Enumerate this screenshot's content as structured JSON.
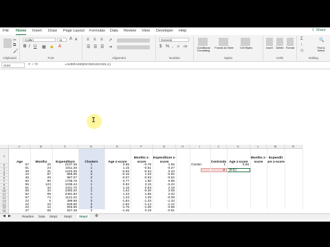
{
  "ribbon_tabs": [
    "File",
    "Home",
    "Insert",
    "Draw",
    "Page Layout",
    "Formulas",
    "Data",
    "Review",
    "View",
    "Developer",
    "Help"
  ],
  "active_tab": "Home",
  "share_label": "Share",
  "groups": {
    "clipboard": "Clipboard",
    "font": "Font",
    "alignment": "Alignment",
    "number": "Number",
    "styles": "Styles",
    "cells": "Cells",
    "editing": "Editing"
  },
  "font_name": "Calibri",
  "font_size": "11",
  "number_format": "General",
  "styles_buttons": [
    "Conditional Formatting",
    "Format as Table",
    "Cell Styles"
  ],
  "cells_buttons": [
    "Insert",
    "Delete",
    "Format"
  ],
  "editing_buttons": [
    "Find & Select"
  ],
  "name_box": "SUM",
  "formula": "=AVERAGE(D2:D20,D2:D21,1)",
  "columns": [
    "A",
    "B",
    "C",
    "D",
    "E",
    "F",
    "G",
    "H",
    "I",
    "J",
    "K",
    "L",
    "M",
    "N"
  ],
  "headers": {
    "age": "Age",
    "months": "Months",
    "expenditure": "Expenditure",
    "clusters": "Clusters",
    "age_z": "Age z-score",
    "months_z": "Months z-score",
    "expenditure_z": "Expenditure z-score",
    "centroids": "Centroids",
    "k_age_z": "Age z-score",
    "l_months_z": "Months z-score",
    "m_expenditure_z": "Expendit ure z-score"
  },
  "cluster_label": "Cluster",
  "cluster_row": {
    "cluster": "1",
    "value": "0.58"
  },
  "editing_cell": {
    "cluster": "2",
    "value": "(E:E)"
  },
  "rows": [
    {
      "n": "2",
      "age": "57",
      "months": "20",
      "exp": "2107.35",
      "cl": "1",
      "az": "0.65",
      "mz": "-0.76",
      "ez": "1.65"
    },
    {
      "n": "3",
      "age": "61",
      "months": "24",
      "exp": "1011.25",
      "cl": "1",
      "az": "1.15",
      "mz": "-0.61",
      "ez": "-0.27"
    },
    {
      "n": "4",
      "age": "39",
      "months": "31",
      "exp": "1223.35",
      "cl": "2",
      "az": "-0.53",
      "mz": "-0.34",
      "ez": "0.10"
    },
    {
      "n": "5",
      "age": "44",
      "months": "87",
      "exp": "865.85",
      "cl": "2",
      "az": "-0.15",
      "mz": "1.33",
      "ez": "-0.92"
    },
    {
      "n": "6",
      "age": "45",
      "months": "26",
      "exp": "867.07",
      "cl": "2",
      "az": "-0.07",
      "mz": "-0.53",
      "ez": "-0.52"
    },
    {
      "n": "7",
      "age": "60",
      "months": "90",
      "exp": "1708.75",
      "cl": "1",
      "az": "0.77",
      "mz": "1.90",
      "ez": "0.95"
    },
    {
      "n": "8",
      "age": "55",
      "months": "123",
      "exp": "1038.44",
      "cl": "1",
      "az": "0.92",
      "mz": "3.15",
      "ez": "-0.22"
    },
    {
      "n": "9",
      "age": "61",
      "months": "34",
      "exp": "2411.70",
      "cl": "1",
      "az": "1.15",
      "mz": "0.53",
      "ez": "2.18"
    },
    {
      "n": "10",
      "age": "66",
      "months": "32",
      "exp": "2350.20",
      "cl": "1",
      "az": "1.54",
      "mz": "-0.30",
      "ez": "2.08"
    },
    {
      "n": "11",
      "age": "62",
      "months": "89",
      "exp": "2491.83",
      "cl": "1",
      "az": "1.23",
      "mz": "1.86",
      "ez": "2.32"
    },
    {
      "n": "12",
      "age": "67",
      "months": "74",
      "exp": "1121.22",
      "cl": "1",
      "az": "1.23",
      "mz": "1.29",
      "ez": "-0.08"
    },
    {
      "n": "13",
      "age": "22",
      "months": "5",
      "exp": "389.68",
      "cl": "2",
      "az": "-1.84",
      "mz": "-1.33",
      "ez": "-1.42"
    },
    {
      "n": "14",
      "age": "22",
      "months": "10",
      "exp": "526.60",
      "cl": "2",
      "az": "-1.84",
      "mz": "-1.14",
      "ez": "-1.12"
    },
    {
      "n": "15",
      "age": "22",
      "months": "12",
      "exp": "846.96",
      "cl": "2",
      "az": "-1.76",
      "mz": "-1.06",
      "ez": "-0.56"
    },
    {
      "n": "16",
      "age": "27",
      "months": "65",
      "exp": "647.45",
      "cl": "2",
      "az": "-1.45",
      "mz": "0.19",
      "ez": "-0.91"
    }
  ],
  "sheet_tabs": [
    "Readme",
    "Data",
    "Step1",
    "Step2",
    "Step3"
  ],
  "active_sheet": "Step3",
  "colors": {
    "accent": "#217346",
    "cluster_fill": "#dde4f2",
    "edit_cell": "#f8d7d7"
  }
}
